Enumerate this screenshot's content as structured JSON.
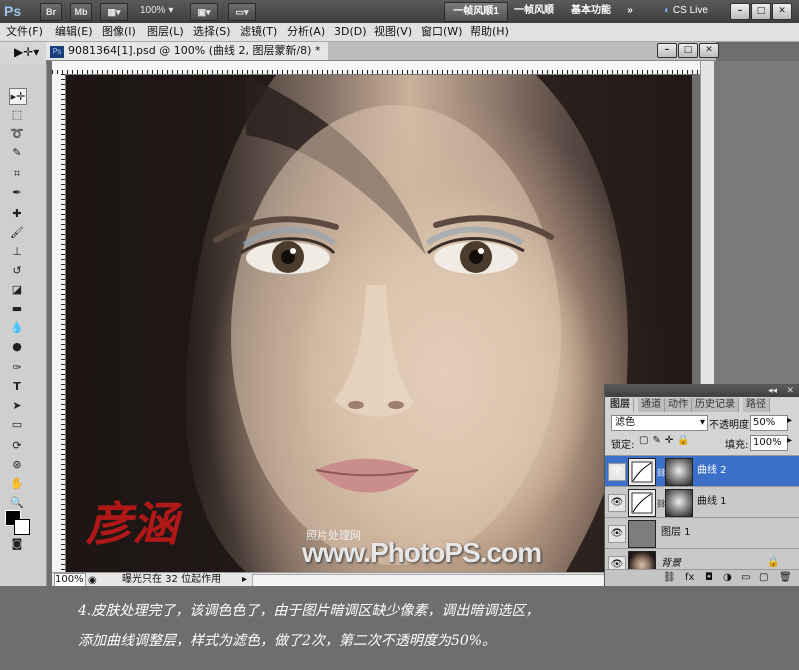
{
  "app": {
    "logo": "Ps",
    "top_buttons": [
      "Br",
      "Mb"
    ],
    "zoom": "100%",
    "workspaces": [
      "一帧风顺1",
      "一帧风顺",
      "基本功能"
    ],
    "more": "»",
    "cs_live": "CS Live",
    "window_controls": [
      "–",
      "□",
      "✕"
    ]
  },
  "menu": [
    "文件(F)",
    "编辑(E)",
    "图像(I)",
    "图层(L)",
    "选择(S)",
    "滤镜(T)",
    "分析(A)",
    "3D(D)",
    "视图(V)",
    "窗口(W)",
    "帮助(H)"
  ],
  "document": {
    "tab_title": "9081364[1].psd @ 100% (曲线 2, 图层蒙新/8) *",
    "doc_icon": "Ps",
    "zoom": "100%",
    "status": "曝光只在 32 位起作用",
    "watermark_site": "照片处理网",
    "watermark_url": "www.PhotoPS.com"
  },
  "layers_panel": {
    "tabs": [
      "图层",
      "通道",
      "动作",
      "历史记录",
      "路径"
    ],
    "blend_mode": "滤色",
    "opacity_label": "不透明度:",
    "opacity": "50%",
    "lock_label": "锁定:",
    "fill_label": "填充:",
    "fill": "100%",
    "layers": [
      {
        "name": "曲线 2",
        "selected": true
      },
      {
        "name": "曲线 1",
        "selected": false
      },
      {
        "name": "图层 1",
        "selected": false
      },
      {
        "name": "背景",
        "selected": false
      }
    ]
  },
  "caption": {
    "line1": "4.皮肤处理完了，该调色色了，由于图片暗调区缺少像素，调出暗调选区，",
    "line2": "添加曲线调整层，样式为滤色，做了2次，第二次不透明度为50%。"
  },
  "colors": {
    "accent": "#3b6fc8",
    "selected_layer": "#3b6fc8"
  }
}
